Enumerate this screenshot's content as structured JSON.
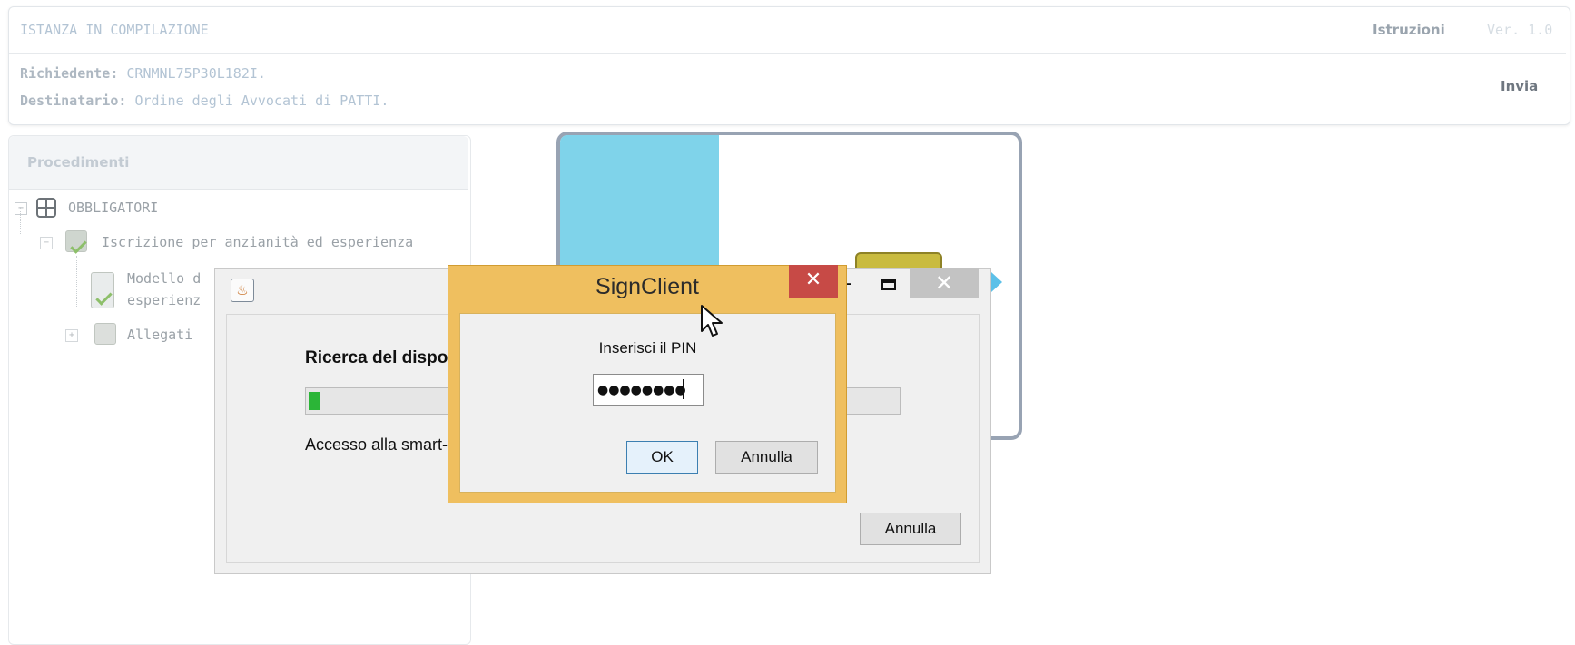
{
  "header": {
    "title": "ISTANZA IN COMPILAZIONE",
    "instructions_link": "Istruzioni",
    "version": "Ver. 1.0",
    "requester_label": "Richiedente:",
    "requester_value": "CRNMNL75P30L182I.",
    "recipient_label": "Destinatario:",
    "recipient_value": "Ordine degli Avvocati di PATTI.",
    "send_button": "Invia"
  },
  "procedures": {
    "title": "Procedimenti",
    "tree": [
      {
        "label": "OBBLIGATORI"
      },
      {
        "label": "Iscrizione per anzianità ed esperienza"
      },
      {
        "label_line1": "Modello d",
        "label_line2": "esperienz"
      },
      {
        "label": "Allegati"
      }
    ]
  },
  "search_window": {
    "title_text": "Ricerca del dispo",
    "progress_value": 0.02,
    "status_text": "Accesso alla smart-",
    "cancel_button": "Annulla",
    "minimize_glyph": "-",
    "close_glyph": "✕",
    "java_icon_glyph": "♨"
  },
  "sign_dialog": {
    "title": "SignClient",
    "close_glyph": "✕",
    "pin_label": "Inserisci il PIN",
    "pin_value": "●●●●●●●●",
    "ok_button": "OK",
    "cancel_button": "Annulla"
  },
  "colors": {
    "dialog_frame": "#efbf5f",
    "close_red": "#c74a46",
    "progress_green": "#2bb537",
    "bg_app_blue": "#7fd3ea"
  }
}
